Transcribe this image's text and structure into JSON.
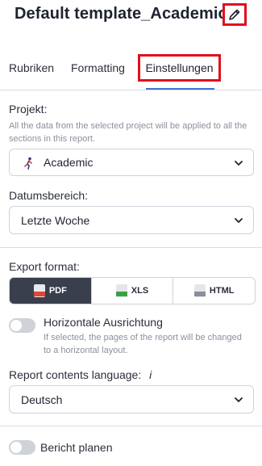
{
  "header": {
    "title": "Default template_Academic",
    "edit_icon": "pencil-icon"
  },
  "tabs": [
    {
      "label": "Rubriken"
    },
    {
      "label": "Formatting"
    },
    {
      "label": "Einstellungen",
      "active": true
    }
  ],
  "project": {
    "label": "Projekt:",
    "hint": "All the data from the selected project will be applied to all the sections in this report.",
    "value": "Academic",
    "icon": "runner-icon"
  },
  "date_range": {
    "label": "Datumsbereich:",
    "value": "Letzte Woche"
  },
  "export": {
    "label": "Export format:",
    "options": [
      {
        "label": "PDF",
        "icon": "pdf-file-icon",
        "active": true
      },
      {
        "label": "XLS",
        "icon": "xls-file-icon",
        "active": false
      },
      {
        "label": "HTML",
        "icon": "html-file-icon",
        "active": false
      }
    ]
  },
  "horizontal": {
    "label": "Horizontale Ausrichtung",
    "hint": "If selected, the pages of the report will be changed to a horizontal layout.",
    "enabled": false
  },
  "language": {
    "label": "Report contents language:",
    "info_glyph": "i",
    "value": "Deutsch"
  },
  "schedule": {
    "label": "Bericht planen",
    "enabled": false
  },
  "colors": {
    "accent": "#3b74d6",
    "highlight": "#e0101f",
    "segment_active": "#3a3f4d"
  }
}
